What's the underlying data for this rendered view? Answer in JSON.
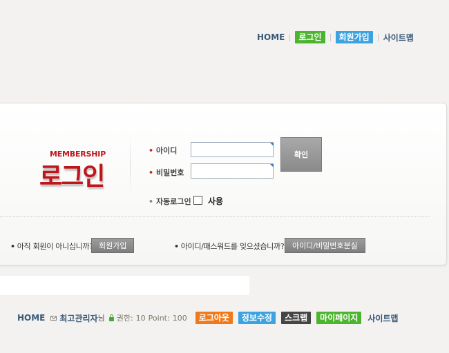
{
  "top_nav": {
    "home": "HOME",
    "login": "로그인",
    "signup": "회원가입",
    "sitemap": "사이트맵",
    "colors": {
      "green": "#4bb52e",
      "blue": "#3ca3e0"
    }
  },
  "login_box": {
    "membership": "MEMBERSHIP",
    "title": "로그인",
    "id_label": "아이디",
    "id_value": "",
    "password_label": "비밀번호",
    "password_value": "",
    "confirm_button": "확인",
    "auto_login_label": "자동로그인",
    "auto_login_use": "사용",
    "auto_login_checked": false,
    "accent_color": "#c0151a"
  },
  "help": {
    "not_member_text": "아직 회원이 아니십니까?",
    "signup_button": "회원가입",
    "forgot_text": "아이디/패스워드를 잊으셨습니까?",
    "find_button": "아이디/비밀번호분실"
  },
  "bottom_nav": {
    "home": "HOME",
    "username": "최고관리자",
    "honorific": "님",
    "level_label": "권한:",
    "level_value": "10",
    "point_label": "Point:",
    "point_value": "100",
    "logout": "로그아웃",
    "edit_info": "정보수정",
    "scrap": "스크랩",
    "mypage": "마이페이지",
    "sitemap": "사이트맵",
    "colors": {
      "orange": "#f07a1b",
      "blue": "#3ca3e0",
      "dark": "#454545",
      "green": "#4bb52e"
    }
  }
}
